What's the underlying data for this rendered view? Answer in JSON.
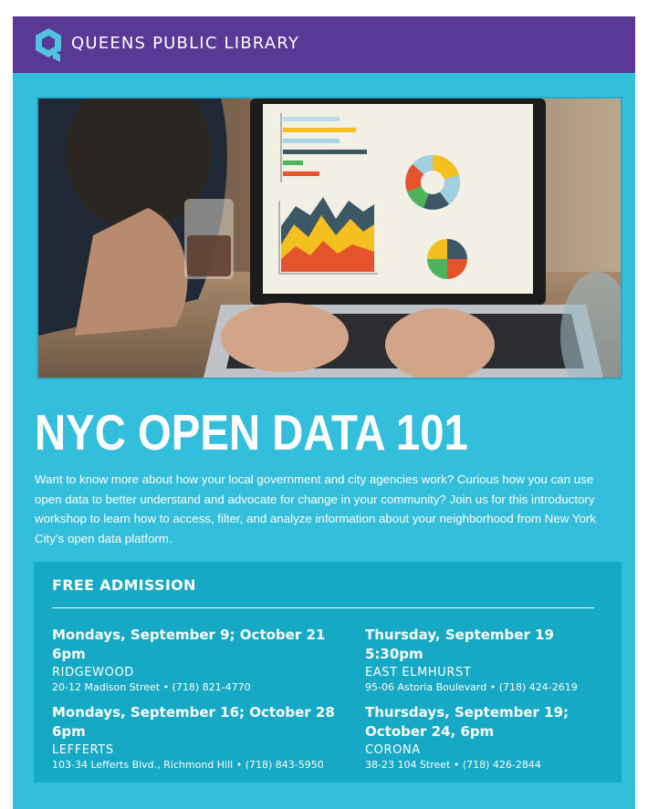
{
  "header": {
    "brand": "QUEENS PUBLIC LIBRARY",
    "logo_icon": "queens-library-q-logo"
  },
  "colors": {
    "header_purple": "#5a3996",
    "poster_cyan": "#33bfdb",
    "info_panel": "#16a9c6",
    "text": "#ffffff"
  },
  "hero_image": {
    "subject": "person typing on laptop showing bar, area and pie charts"
  },
  "title": "NYC OPEN DATA 101",
  "description": "Want to know more about how your local government and city agencies work? Curious how you can use open data to better understand and advocate for change in your community? Join us for this introductory workshop to learn how to access, filter, and analyze information about your neighborhood from New York City’s open data platform.",
  "info": {
    "admission": "FREE ADMISSION",
    "events": [
      {
        "when_line1": "Mondays, September 9; October 21",
        "when_line2": "6pm",
        "location": "RIDGEWOOD",
        "address": "20-12 Madison Street • (718) 821-4770"
      },
      {
        "when_line1": "Thursday, September 19",
        "when_line2": "5:30pm",
        "location": "EAST ELMHURST",
        "address": "95-06 Astoria Boulevard • (718) 424-2619"
      },
      {
        "when_line1": "Mondays, September 16; October 28",
        "when_line2": "6pm",
        "location": "LEFFERTS",
        "address": "103-34 Lefferts Blvd., Richmond Hill • (718) 843-5950"
      },
      {
        "when_line1": "Thursdays, September 19;",
        "when_line2": "October 24, 6pm",
        "location": "CORONA",
        "address": "38-23 104 Street • (718) 426-2844"
      }
    ]
  }
}
